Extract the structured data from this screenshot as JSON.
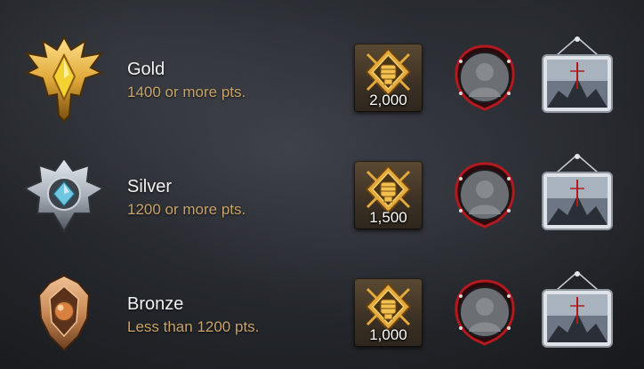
{
  "tiers": [
    {
      "id": "gold",
      "name": "Gold",
      "requirement": "1400 or more pts.",
      "reward_amount": "2,000",
      "emblem_icon": "gold-rank-emblem-icon",
      "colors": {
        "primary": "#e0a93a",
        "light": "#ffe08a",
        "dark": "#7a4f12",
        "gem": "#f5d233"
      }
    },
    {
      "id": "silver",
      "name": "Silver",
      "requirement": "1200 or more pts.",
      "reward_amount": "1,500",
      "emblem_icon": "silver-rank-emblem-icon",
      "colors": {
        "primary": "#a9b1bb",
        "light": "#e6ebf0",
        "dark": "#4d545c",
        "gem": "#6fc6e0"
      }
    },
    {
      "id": "bronze",
      "name": "Bronze",
      "requirement": "Less than 1200 pts.",
      "reward_amount": "1,000",
      "emblem_icon": "bronze-rank-emblem-icon",
      "colors": {
        "primary": "#c98a55",
        "light": "#f0c195",
        "dark": "#6b3d1e",
        "gem": "#d9813f"
      }
    }
  ],
  "reward_icons": {
    "currency": "fist-medal-icon",
    "portrait_frame": "portrait-frame-icon",
    "backdrop": "backdrop-card-icon"
  },
  "accent_colors": {
    "requirement_text": "#c9a36a",
    "name_text": "#f2f2f2",
    "frame_red": "#b3191f",
    "currency_gold": "#e3a93b"
  }
}
